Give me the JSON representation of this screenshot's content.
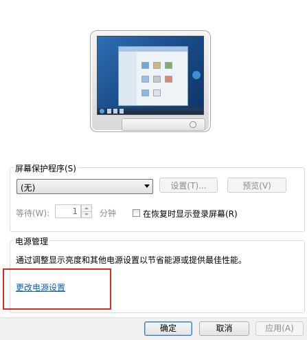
{
  "screensaver": {
    "group_label": "屏幕保护程序(S)",
    "selected": "(无)",
    "settings_button": "设置(T)...",
    "preview_button": "预览(V)",
    "wait_label": "等待(W):",
    "wait_value": "1",
    "wait_unit": "分钟",
    "resume_logon_label": "在恢复时显示登录屏幕(R)",
    "resume_logon_checked": false
  },
  "power": {
    "group_label": "电源管理",
    "description": "通过调整显示亮度和其他电源设置以节省能源或提供最佳性能。",
    "link": "更改电源设置"
  },
  "dialog_buttons": {
    "ok": "确定",
    "cancel": "取消",
    "apply": "应用(A)"
  },
  "colors": {
    "link": "#0b5fae",
    "highlight_box": "#e0281f"
  }
}
